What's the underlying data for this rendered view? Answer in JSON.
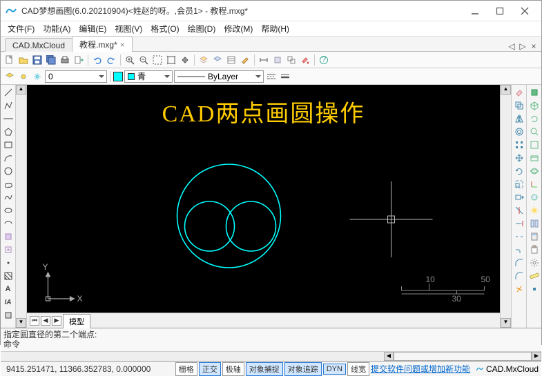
{
  "title": "CAD梦想画图(6.0.20210904)<姓赵的呀。,会员1> - 教程.mxg*",
  "menu": [
    "文件(F)",
    "功能(A)",
    "编辑(E)",
    "视图(V)",
    "格式(O)",
    "绘图(D)",
    "修改(M)",
    "帮助(H)"
  ],
  "tabs": [
    {
      "label": "CAD.MxCloud",
      "active": false
    },
    {
      "label": "教程.mxg*",
      "active": true
    }
  ],
  "color_select": {
    "label": "青",
    "swatch": "#00ffff"
  },
  "linetype_select": {
    "label": "ByLayer"
  },
  "canvas": {
    "headline": "CAD两点画圆操作",
    "axis": {
      "x": "X",
      "y": "Y"
    },
    "scale": {
      "t10": "10",
      "t30": "30",
      "t50": "50"
    }
  },
  "bottom_tabs": {
    "model": "模型"
  },
  "cmd": {
    "prompt": "指定圆直径的第二个端点:",
    "label": "命令"
  },
  "status": {
    "coords": "9415.251471, 11366.352783, 0.000000",
    "buttons": [
      "栅格",
      "正交",
      "极轴",
      "对象捕捉",
      "对象追踪",
      "DYN",
      "线宽"
    ],
    "active": [
      false,
      true,
      false,
      true,
      true,
      true,
      false
    ],
    "link": "提交软件问题或增加新功能",
    "brand": "CAD.MxCloud"
  }
}
